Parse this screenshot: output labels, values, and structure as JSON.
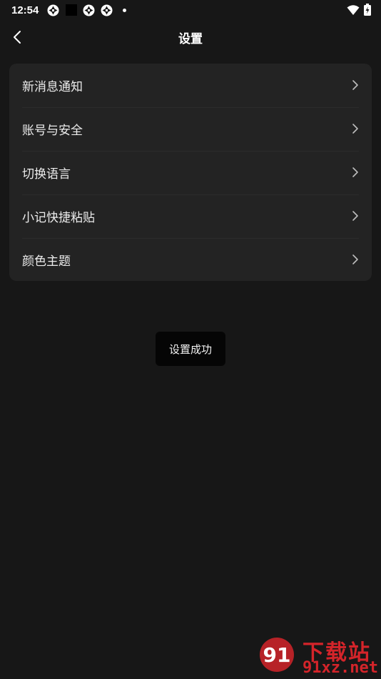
{
  "status_bar": {
    "time": "12:54",
    "icons_left": [
      "sync-icon",
      "black-square-icon",
      "sync-icon",
      "sync-icon",
      "dot-icon"
    ],
    "icons_right": [
      "wifi-icon",
      "battery-charging-icon"
    ]
  },
  "app_bar": {
    "back_icon": "chevron-left-icon",
    "title": "设置"
  },
  "settings": {
    "items": [
      {
        "label": "新消息通知",
        "icon": "chevron-right-icon"
      },
      {
        "label": "账号与安全",
        "icon": "chevron-right-icon"
      },
      {
        "label": "切换语言",
        "icon": "chevron-right-icon"
      },
      {
        "label": "小记快捷粘贴",
        "icon": "chevron-right-icon"
      },
      {
        "label": "颜色主题",
        "icon": "chevron-right-icon"
      }
    ]
  },
  "toast": {
    "text": "设置成功"
  },
  "watermark": {
    "title": "下载站",
    "domain": "91xz.net",
    "logo_text": "91"
  },
  "colors": {
    "background": "#171717",
    "card": "#232323",
    "toast": "#050505",
    "watermark": "#d4242a"
  }
}
